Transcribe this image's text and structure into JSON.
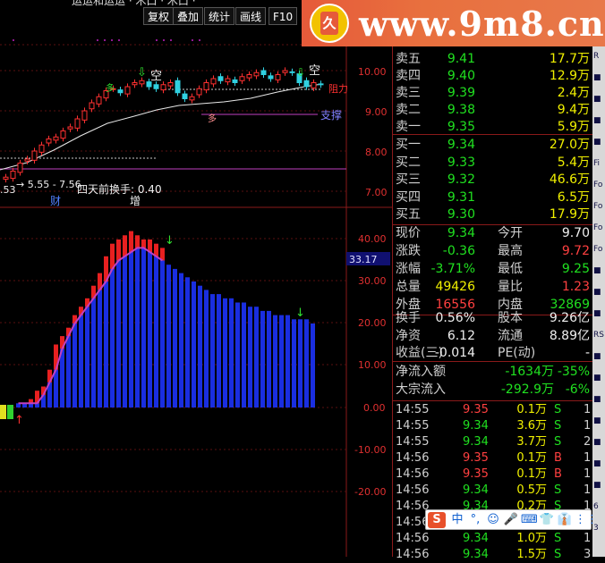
{
  "toolbar": {
    "partial_title": "运运和运运 · 木口 · 木口 ·",
    "buttons": [
      "复权",
      "叠加",
      "统计",
      "画线",
      "F10"
    ]
  },
  "logo": {
    "text": "www.9m8.cn",
    "mark": "久"
  },
  "upper_chart": {
    "price_axis": [
      "10.00",
      "9.00",
      "8.00",
      "7.00"
    ],
    "labels": {
      "kong1": "空",
      "kong2": "空",
      "duo1": "多",
      "duo2": "多",
      "support": "支撑",
      "range": "→ 5.55 - 7.56",
      "turnover": "四天前换手: 0.40",
      "cai": "财",
      "zeng": "增",
      "left_val": ".53",
      "resist": "阻力"
    }
  },
  "lower_chart": {
    "axis": [
      "40.00",
      "30.00",
      "20.00",
      "10.00",
      "0.00",
      "-10.00",
      "-20.00"
    ],
    "current_value": "33.17",
    "chart_data": {
      "type": "bar",
      "series": [
        {
          "values": [
            1,
            1,
            1,
            1,
            3,
            6,
            9,
            14,
            17,
            20,
            22,
            24,
            26,
            28,
            30,
            33,
            35,
            36,
            37,
            38,
            38,
            37,
            36,
            35,
            34,
            33,
            32,
            31,
            30,
            29,
            28,
            27,
            27,
            26,
            26,
            25,
            25,
            24,
            24,
            23,
            23,
            22,
            22,
            22,
            21,
            21,
            21,
            20
          ]
        },
        {
          "values": [
            0,
            1,
            2,
            4,
            5,
            9,
            15,
            17,
            19,
            22,
            24,
            26,
            29,
            32,
            36,
            39,
            40,
            41,
            42,
            41,
            40,
            40,
            39,
            38
          ]
        }
      ]
    }
  },
  "quote": {
    "asks": [
      {
        "label": "卖五",
        "price": "9.41",
        "vol": "17.7万"
      },
      {
        "label": "卖四",
        "price": "9.40",
        "vol": "12.9万"
      },
      {
        "label": "卖三",
        "price": "9.39",
        "vol": "2.4万"
      },
      {
        "label": "卖二",
        "price": "9.38",
        "vol": "9.4万"
      },
      {
        "label": "卖一",
        "price": "9.35",
        "vol": "5.9万"
      }
    ],
    "bids": [
      {
        "label": "买一",
        "price": "9.34",
        "vol": "27.0万"
      },
      {
        "label": "买二",
        "price": "9.33",
        "vol": "5.4万"
      },
      {
        "label": "买三",
        "price": "9.32",
        "vol": "46.6万"
      },
      {
        "label": "买四",
        "price": "9.31",
        "vol": "6.5万"
      },
      {
        "label": "买五",
        "price": "9.30",
        "vol": "17.9万"
      }
    ],
    "stats": [
      {
        "k1": "现价",
        "v1": "9.34",
        "c1": "g",
        "k2": "今开",
        "v2": "9.70",
        "c2": "w"
      },
      {
        "k1": "涨跌",
        "v1": "-0.36",
        "c1": "g",
        "k2": "最高",
        "v2": "9.72",
        "c2": "r"
      },
      {
        "k1": "涨幅",
        "v1": "-3.71%",
        "c1": "g",
        "k2": "最低",
        "v2": "9.25",
        "c2": "g"
      },
      {
        "k1": "总量",
        "v1": "49426",
        "c1": "y",
        "k2": "量比",
        "v2": "1.23",
        "c2": "r"
      },
      {
        "k1": "外盘",
        "v1": "16556",
        "c1": "r",
        "k2": "内盘",
        "v2": "32869",
        "c2": "g"
      }
    ],
    "stats2": [
      {
        "k1": "换手",
        "v1": "0.56%",
        "k2": "股本",
        "v2": "9.26亿"
      },
      {
        "k1": "净资",
        "v1": "6.12",
        "k2": "流通",
        "v2": "8.89亿"
      },
      {
        "k1": "收益(三)",
        "v1": "-0.014",
        "k2": "PE(动)",
        "v2": "-"
      }
    ],
    "flows": [
      {
        "k": "净流入额",
        "v1": "-1634万",
        "v2": "-35%"
      },
      {
        "k": "大宗流入",
        "v1": "-292.9万",
        "v2": "-6%"
      }
    ],
    "ticks": [
      {
        "t": "14:55",
        "p": "9.35",
        "v": "0.1万",
        "s": "S",
        "n": "1"
      },
      {
        "t": "14:55",
        "p": "9.34",
        "v": "3.6万",
        "s": "S",
        "n": "1"
      },
      {
        "t": "14:55",
        "p": "9.34",
        "v": "3.7万",
        "s": "S",
        "n": "2"
      },
      {
        "t": "14:56",
        "p": "9.35",
        "v": "0.1万",
        "s": "B",
        "n": "1"
      },
      {
        "t": "14:56",
        "p": "9.35",
        "v": "0.1万",
        "s": "B",
        "n": "1"
      },
      {
        "t": "14:56",
        "p": "9.34",
        "v": "0.5万",
        "s": "S",
        "n": "1"
      },
      {
        "t": "14:56",
        "p": "9.34",
        "v": "0.2万",
        "s": "S",
        "n": "1"
      },
      {
        "t": "14:56",
        "p": "9.34",
        "v": "0.1万",
        "s": "S",
        "n": "1"
      },
      {
        "t": "14:56",
        "p": "9.34",
        "v": "1.0万",
        "s": "S",
        "n": "1"
      },
      {
        "t": "14:56",
        "p": "9.34",
        "v": "1.5万",
        "s": "S",
        "n": "3"
      }
    ]
  },
  "ime": {
    "items": [
      "S",
      "中",
      "°,",
      "☺",
      "🎤",
      "⌨",
      "👕",
      "👔",
      "⋮⋮"
    ]
  },
  "strip": {
    "items": [
      "R",
      "■",
      "■",
      "■",
      "■",
      "Fi",
      "Fo",
      "Fo",
      "Fo",
      "Fo",
      "■",
      "■",
      "■",
      "RS",
      "■",
      "■",
      "■",
      "■",
      "■",
      "■",
      "■",
      "6",
      "3"
    ]
  }
}
